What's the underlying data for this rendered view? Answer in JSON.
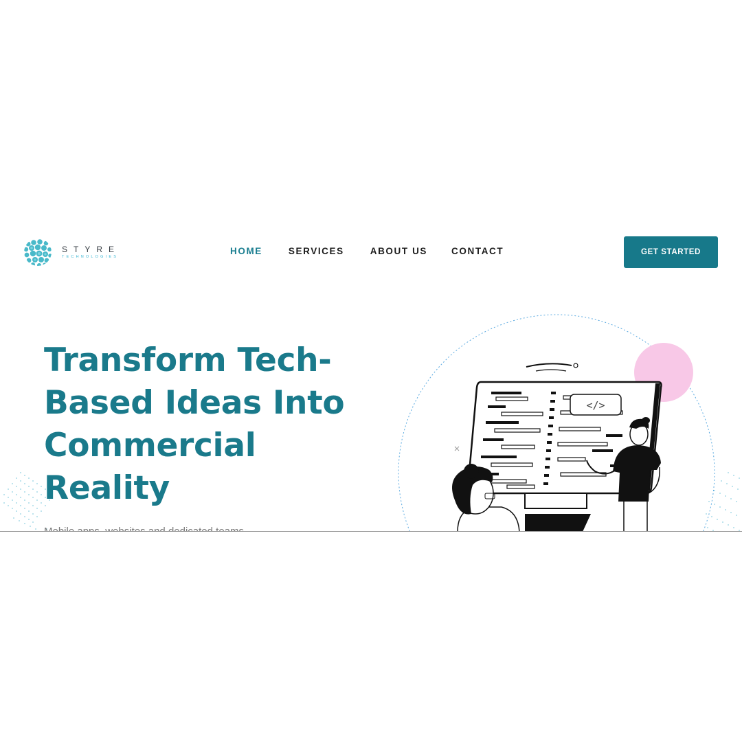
{
  "brand": {
    "name": "STYRE",
    "tagline": "TECHNOLOGIES",
    "colors": {
      "primary": "#17798a",
      "accent": "#3db7d4",
      "pink": "#f7c9e6"
    }
  },
  "nav": {
    "items": [
      {
        "label": "HOME",
        "active": true
      },
      {
        "label": "SERVICES",
        "active": false
      },
      {
        "label": "ABOUT US",
        "active": false
      },
      {
        "label": "CONTACT",
        "active": false
      }
    ]
  },
  "header": {
    "cta_label": "GET STARTED"
  },
  "hero": {
    "title_lines": [
      "Transform Tech-",
      "Based Ideas Into",
      "Commercial",
      "Reality"
    ],
    "subtitle": "Mobile apps, websites and dedicated teams"
  },
  "illustration": {
    "code_bubble": "</>",
    "icons": [
      "logo-mark-icon",
      "code-bubble-icon",
      "monitor-icon"
    ]
  }
}
